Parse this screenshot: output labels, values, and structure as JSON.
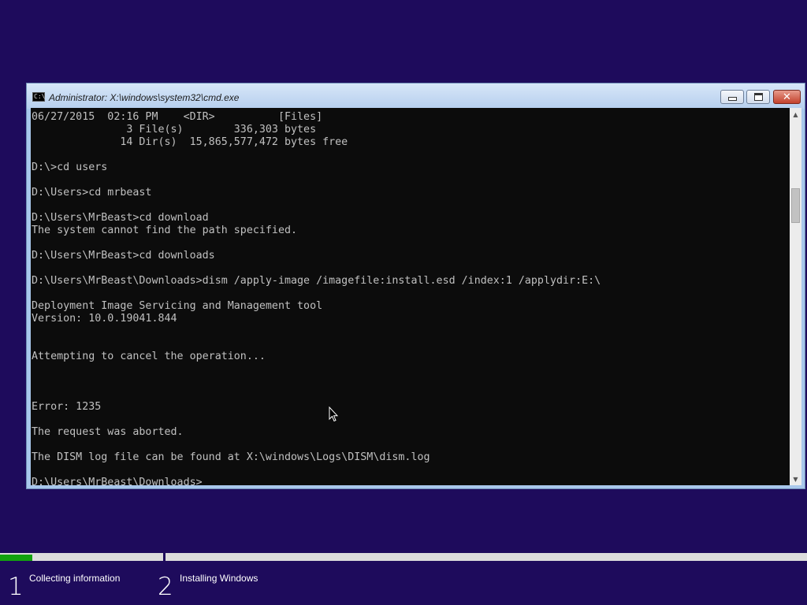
{
  "window": {
    "title": "Administrator: X:\\windows\\system32\\cmd.exe",
    "icon_label": "C:\\",
    "minimize_icon": "minimize-icon",
    "maximize_icon": "maximize-icon",
    "close_icon": "close-icon",
    "close_glyph": "✕"
  },
  "console": {
    "lines": [
      "06/27/2015  02:16 PM    <DIR>          [Files]",
      "               3 File(s)        336,303 bytes",
      "              14 Dir(s)  15,865,577,472 bytes free",
      "",
      "D:\\>cd users",
      "",
      "D:\\Users>cd mrbeast",
      "",
      "D:\\Users\\MrBeast>cd download",
      "The system cannot find the path specified.",
      "",
      "D:\\Users\\MrBeast>cd downloads",
      "",
      "D:\\Users\\MrBeast\\Downloads>dism /apply-image /imagefile:install.esd /index:1 /applydir:E:\\",
      "",
      "Deployment Image Servicing and Management tool",
      "Version: 10.0.19041.844",
      "",
      "",
      "Attempting to cancel the operation...",
      "",
      "",
      "",
      "Error: 1235",
      "",
      "The request was aborted.",
      "",
      "The DISM log file can be found at X:\\windows\\Logs\\DISM\\dism.log",
      ""
    ],
    "prompt": "D:\\Users\\MrBeast\\Downloads>"
  },
  "scrollbar": {
    "up_arrow": "▲",
    "down_arrow": "▼"
  },
  "setup": {
    "progress_fraction": 0.04,
    "accent_color": "#13a10e",
    "background_color": "#1e0b5c",
    "steps": [
      {
        "number": "1",
        "label": "Collecting information"
      },
      {
        "number": "2",
        "label": "Installing Windows"
      }
    ]
  }
}
